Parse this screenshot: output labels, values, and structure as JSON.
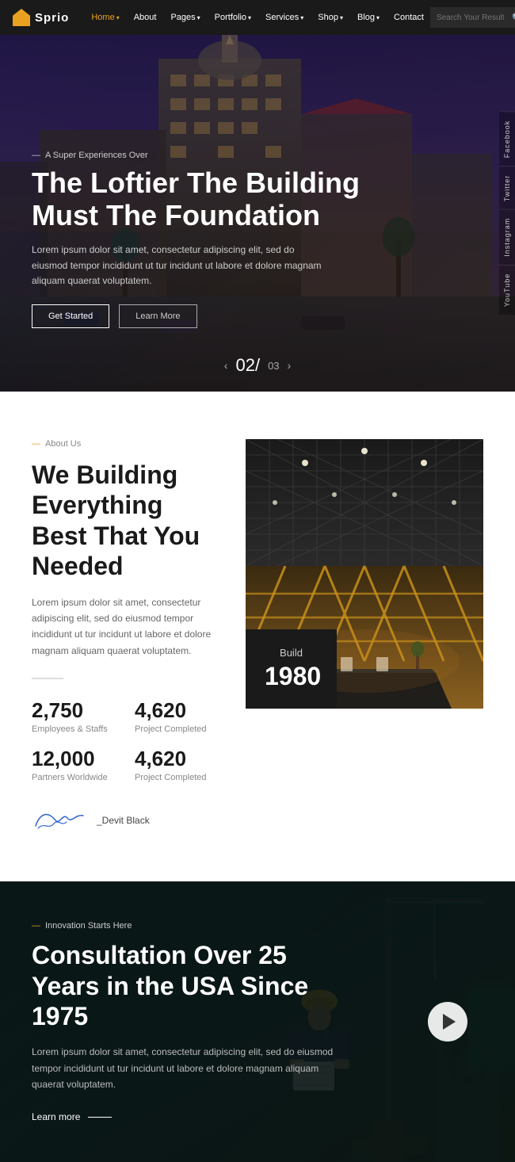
{
  "navbar": {
    "logo_text": "Sprio",
    "nav_items": [
      {
        "label": "Home",
        "active": true,
        "has_dropdown": true
      },
      {
        "label": "About",
        "active": false,
        "has_dropdown": false
      },
      {
        "label": "Pages",
        "active": false,
        "has_dropdown": true
      },
      {
        "label": "Portfolio",
        "active": false,
        "has_dropdown": true
      },
      {
        "label": "Services",
        "active": false,
        "has_dropdown": true
      },
      {
        "label": "Shop",
        "active": false,
        "has_dropdown": true
      },
      {
        "label": "Blog",
        "active": false,
        "has_dropdown": true
      },
      {
        "label": "Contact",
        "active": false,
        "has_dropdown": false
      }
    ],
    "search_placeholder": "Search Your Result"
  },
  "hero": {
    "super_text": "A Super Experiences Over",
    "title": "The Loftier The Building Must The Foundation",
    "description": "Lorem ipsum dolor sit amet, consectetur adipiscing elit, sed do eiusmod tempor incididunt ut tur incidunt ut labore et dolore magnam aliquam quaerat voluptatem.",
    "btn_primary": "Get Started",
    "btn_secondary": "Learn More",
    "slide_current": "02/",
    "slide_total": "03",
    "socials": [
      "Facebook",
      "Twitter",
      "Instagram",
      "YouTube"
    ]
  },
  "about": {
    "label": "About Us",
    "title": "We Building Everything Best That You Needed",
    "description": "Lorem ipsum dolor sit amet, consectetur adipiscing elit, sed do eiusmod tempor incididunt ut tur incidunt ut labore et dolore magnam aliquam quaerat voluptatem.",
    "stats": [
      {
        "number": "2,750",
        "label": "Employees & Staffs"
      },
      {
        "number": "4,620",
        "label": "Project Completed"
      },
      {
        "number": "12,000",
        "label": "Partners Worldwide"
      },
      {
        "number": "4,620",
        "label": "Project Completed"
      }
    ],
    "signature_name": "_Devit Black",
    "build_label": "Build",
    "build_year": "1980"
  },
  "consultation": {
    "label": "Innovation Starts Here",
    "title": "Consultation Over 25 Years in the USA Since 1975",
    "description": "Lorem ipsum dolor sit amet, consectetur adipiscing elit, sed do eiusmod tempor incididunt ut tur incidunt ut labore et dolore magnam aliquam quaerat voluptatem.",
    "learn_more": "Learn more"
  }
}
